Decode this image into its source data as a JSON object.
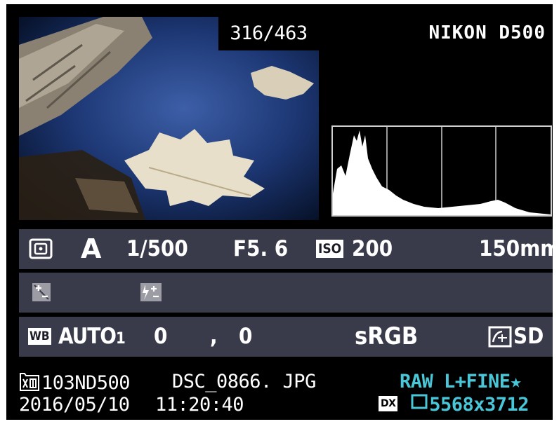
{
  "counter": "316/463",
  "camera_model": "NIKON D500",
  "exposure": {
    "metering_icon": "matrix-metering-icon",
    "mode": "A",
    "shutter": "1/500",
    "aperture": "F5. 6",
    "iso_label": "ISO",
    "iso_value": "200",
    "focal_length": "150mm"
  },
  "compensation": {
    "exposure_comp_icon": "exposure-compensation-icon",
    "flash_comp_icon": "flash-compensation-icon"
  },
  "white_balance": {
    "wb_label": "WB",
    "mode": "AUTO",
    "sub": "1",
    "fine_tune_a": "0",
    "separator": ",",
    "fine_tune_b": "0",
    "color_space": "sRGB",
    "picture_control_icon": "picture-control-icon",
    "picture_control": "SD"
  },
  "file": {
    "folder_icon": "folder-icon",
    "folder": "103ND500",
    "filename": "DSC_0866. JPG",
    "quality": "RAW L+FINE★",
    "date": "2016/05/10",
    "time": "11:20:40",
    "dx_label": "DX",
    "image_size": "5568x3712"
  },
  "colors": {
    "screen_bg": "#000000",
    "row_bg": "#3a3b4a",
    "accent_cyan": "#49c7d8",
    "text": "#ffffff"
  }
}
